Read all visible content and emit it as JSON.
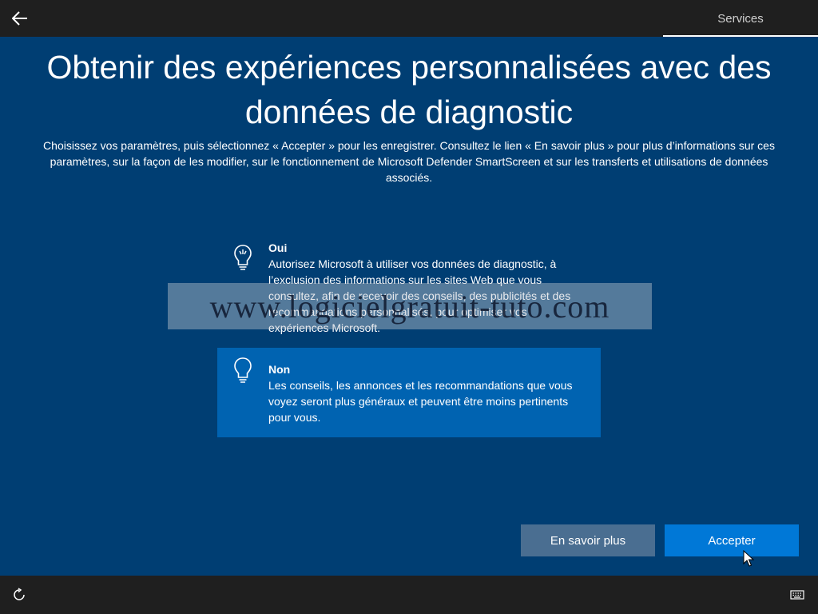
{
  "header": {
    "back_icon": "arrow-left-icon",
    "section_label": "Services"
  },
  "main": {
    "title": "Obtenir des expériences personnalisées avec des données de diagnostic",
    "subtitle": "Choisissez vos paramètres, puis sélectionnez « Accepter » pour les enregistrer. Consultez le lien « En savoir plus » pour plus d’informations sur ces paramètres, sur la façon de les modifier, sur le fonctionnement de Microsoft Defender SmartScreen et sur les transferts et utilisations de données associés."
  },
  "options": [
    {
      "title": "Oui",
      "description": "Autorisez Microsoft à utiliser vos données de diagnostic, à l’exclusion des informations sur les sites Web que vous consultez, afin de recevoir des conseils, des publicités et des recommandations personnalisés, pour optimiser vos expériences Microsoft.",
      "icon": "lightbulb-on-icon",
      "selected": false
    },
    {
      "title": "Non",
      "description": "Les conseils, les annonces et les recommandations que vous voyez seront plus généraux et peuvent être moins pertinents pour vous.",
      "icon": "lightbulb-icon",
      "selected": true
    }
  ],
  "watermark": "www.logicielgratuit-tuto.com",
  "buttons": {
    "learn_more": "En savoir plus",
    "accept": "Accepter"
  },
  "footer": {
    "accessibility_icon": "ease-of-access-icon",
    "keyboard_icon": "keyboard-icon"
  },
  "colors": {
    "background": "#003e73",
    "bars": "#1f1f1f",
    "selected_option": "#0063b1",
    "accept_button": "#0078d7",
    "secondary_button": "#4a6e91"
  }
}
